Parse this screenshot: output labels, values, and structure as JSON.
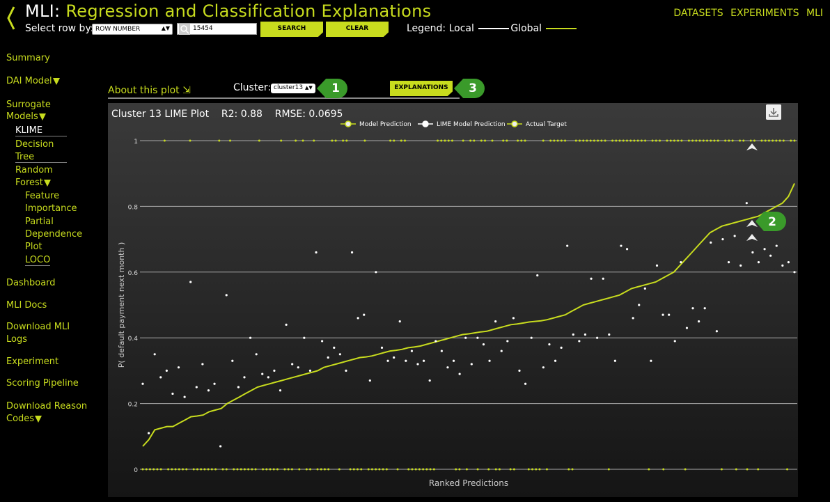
{
  "header": {
    "title_prefix": "MLI:",
    "title_main": "Regression and Classification Explanations",
    "nav": [
      "DATASETS",
      "EXPERIMENTS",
      "MLI"
    ],
    "select_row_label": "Select row by:",
    "row_select_value": "ROW NUMBER",
    "search_value": "15454",
    "search_button": "SEARCH",
    "clear_button": "CLEAR",
    "legend_label": "Legend: Local",
    "legend_global": "Global"
  },
  "sidebar": {
    "summary": "Summary",
    "dai_model": "DAI Model",
    "surrogate_1": "Surrogate",
    "surrogate_2": "Models",
    "klime": "KLIME",
    "decision_1": "Decision",
    "decision_2": "Tree",
    "random_1": "Random",
    "random_2": "Forest",
    "feature_1": "Feature",
    "feature_2": "Importance",
    "partial_1": "Partial",
    "partial_2": "Dependence",
    "partial_3": "Plot",
    "loco": "LOCO",
    "dashboard": "Dashboard",
    "mli_docs": "MLI Docs",
    "download_logs_1": "Download MLI",
    "download_logs_2": "Logs",
    "experiment": "Experiment",
    "scoring": "Scoring Pipeline",
    "reason_1": "Download Reason",
    "reason_2": "Codes"
  },
  "controls": {
    "about": "About this plot",
    "cluster_label": "Cluster:",
    "cluster_value": "cluster13",
    "explanations_button": "EXPLANATIONS",
    "badges": [
      "1",
      "2",
      "3"
    ]
  },
  "colors": {
    "accent": "#c8dc1e",
    "badge": "#3a9a2a",
    "background": "#000000"
  },
  "icons": [
    "back-chevron-icon",
    "search-icon",
    "download-icon",
    "pointer-arrow-icon"
  ],
  "chart_data": {
    "type": "line",
    "title": "Cluster 13 LIME Plot",
    "r2": "R2: 0.88",
    "rmse": "RMSE: 0.0695",
    "xlabel": "Ranked Predictions",
    "ylabel": "P( default payment next month )",
    "ylim": [
      0,
      1
    ],
    "yticks": [
      0,
      0.2,
      0.4,
      0.6,
      0.8,
      1
    ],
    "ytick_labels": [
      "0",
      "0.2",
      "0.4",
      "0.6",
      "0.8",
      "1"
    ],
    "legend": [
      "Model Prediction",
      "LIME Model Prediction",
      "Actual Target"
    ],
    "model_prediction": [
      0.07,
      0.09,
      0.12,
      0.125,
      0.13,
      0.13,
      0.14,
      0.15,
      0.16,
      0.162,
      0.165,
      0.175,
      0.18,
      0.185,
      0.2,
      0.21,
      0.22,
      0.23,
      0.24,
      0.25,
      0.255,
      0.26,
      0.265,
      0.27,
      0.275,
      0.28,
      0.285,
      0.29,
      0.295,
      0.3,
      0.31,
      0.315,
      0.32,
      0.325,
      0.33,
      0.335,
      0.34,
      0.342,
      0.345,
      0.35,
      0.355,
      0.36,
      0.362,
      0.365,
      0.37,
      0.372,
      0.375,
      0.38,
      0.385,
      0.39,
      0.395,
      0.4,
      0.405,
      0.41,
      0.412,
      0.415,
      0.418,
      0.42,
      0.425,
      0.43,
      0.435,
      0.44,
      0.442,
      0.445,
      0.448,
      0.45,
      0.452,
      0.455,
      0.46,
      0.465,
      0.47,
      0.48,
      0.49,
      0.5,
      0.505,
      0.51,
      0.515,
      0.52,
      0.525,
      0.53,
      0.54,
      0.55,
      0.555,
      0.56,
      0.565,
      0.57,
      0.58,
      0.59,
      0.6,
      0.62,
      0.64,
      0.66,
      0.68,
      0.7,
      0.72,
      0.73,
      0.74,
      0.745,
      0.75,
      0.755,
      0.76,
      0.765,
      0.77,
      0.78,
      0.79,
      0.8,
      0.81,
      0.83,
      0.87
    ],
    "lime_prediction": [
      0.26,
      0.11,
      0.35,
      0.28,
      0.3,
      0.23,
      0.31,
      0.22,
      0.57,
      0.25,
      0.32,
      0.24,
      0.26,
      0.07,
      0.53,
      0.33,
      0.25,
      0.28,
      0.4,
      0.35,
      0.29,
      0.28,
      0.3,
      0.24,
      0.44,
      0.32,
      0.31,
      0.4,
      0.3,
      0.66,
      0.39,
      0.34,
      0.37,
      0.35,
      0.3,
      0.66,
      0.46,
      0.47,
      0.27,
      0.6,
      0.37,
      0.33,
      0.34,
      0.45,
      0.33,
      0.36,
      0.32,
      0.33,
      0.27,
      0.39,
      0.36,
      0.31,
      0.33,
      0.29,
      0.4,
      0.32,
      0.4,
      0.38,
      0.33,
      0.45,
      0.36,
      0.39,
      0.46,
      0.3,
      0.26,
      0.4,
      0.59,
      0.31,
      0.38,
      0.33,
      0.37,
      0.68,
      0.41,
      0.39,
      0.41,
      0.58,
      0.4,
      0.58,
      0.41,
      0.33,
      0.68,
      0.67,
      0.46,
      0.5,
      0.55,
      0.33,
      0.62,
      0.47,
      0.47,
      0.39,
      0.63,
      0.43,
      0.49,
      0.45,
      0.49,
      0.69,
      0.42,
      0.7,
      0.63,
      0.71,
      0.62,
      0.81,
      0.66,
      0.63,
      0.67,
      0.65,
      0.68,
      0.62,
      0.63,
      0.6
    ],
    "actual_target_count": 180
  }
}
